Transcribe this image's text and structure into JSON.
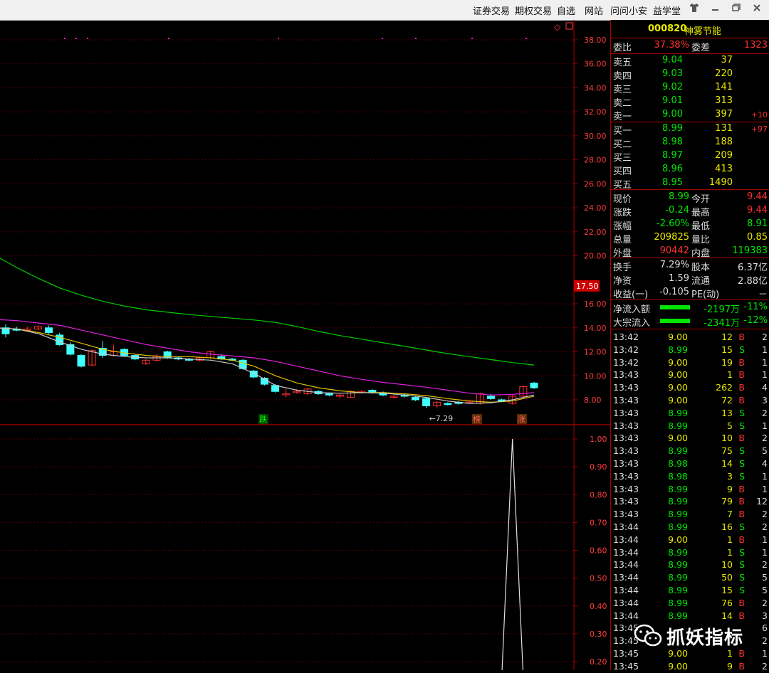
{
  "menu": {
    "items": [
      "证券交易",
      "期权交易",
      "自选",
      "网站",
      "问问小安",
      "益学堂"
    ],
    "window_controls": [
      "shirt-icon",
      "minimize-icon",
      "restore-icon",
      "close-icon"
    ]
  },
  "stock": {
    "code": "000820",
    "name": "神雾节能"
  },
  "order_ratio": {
    "label1": "委比",
    "value1": "37.38%",
    "label2": "委差",
    "value2": "1323"
  },
  "asks": [
    {
      "label": "卖五",
      "price": "9.04",
      "vol": "37",
      "change": ""
    },
    {
      "label": "卖四",
      "price": "9.03",
      "vol": "220",
      "change": ""
    },
    {
      "label": "卖三",
      "price": "9.02",
      "vol": "141",
      "change": ""
    },
    {
      "label": "卖二",
      "price": "9.01",
      "vol": "313",
      "change": ""
    },
    {
      "label": "卖一",
      "price": "9.00",
      "vol": "397",
      "change": "+10"
    }
  ],
  "bids": [
    {
      "label": "买一",
      "price": "8.99",
      "vol": "131",
      "change": "+97"
    },
    {
      "label": "买二",
      "price": "8.98",
      "vol": "188",
      "change": ""
    },
    {
      "label": "买三",
      "price": "8.97",
      "vol": "209",
      "change": ""
    },
    {
      "label": "买四",
      "price": "8.96",
      "vol": "413",
      "change": ""
    },
    {
      "label": "买五",
      "price": "8.95",
      "vol": "1490",
      "change": ""
    }
  ],
  "quote": [
    {
      "l1": "现价",
      "v1": "8.99",
      "l2": "今开",
      "v2": "9.44",
      "c1": "green",
      "c2": "red"
    },
    {
      "l1": "涨跌",
      "v1": "-0.24",
      "l2": "最高",
      "v2": "9.44",
      "c1": "green",
      "c2": "red"
    },
    {
      "l1": "涨幅",
      "v1": "-2.60%",
      "l2": "最低",
      "v2": "8.91",
      "c1": "green",
      "c2": "green"
    },
    {
      "l1": "总量",
      "v1": "209825",
      "l2": "量比",
      "v2": "0.85",
      "c1": "yellow",
      "c2": "yellow"
    },
    {
      "l1": "外盘",
      "v1": "90442",
      "l2": "内盘",
      "v2": "119383",
      "c1": "red",
      "c2": "green"
    }
  ],
  "fundamentals": [
    {
      "l1": "换手",
      "v1": "7.29%",
      "l2": "股本",
      "v2": "6.37亿"
    },
    {
      "l1": "净资",
      "v1": "1.59",
      "l2": "流通",
      "v2": "2.88亿"
    },
    {
      "l1": "收益(一)",
      "v1": "-0.105",
      "l2": "PE(动)",
      "v2": "－"
    }
  ],
  "flows": [
    {
      "label": "净流入额",
      "value": "-2197万",
      "pct": "-11%"
    },
    {
      "label": "大宗流入",
      "value": "-2341万",
      "pct": "-12%"
    }
  ],
  "ticks": [
    {
      "t": "13:42",
      "p": "9.00",
      "v": "12",
      "d": "B",
      "n": "2"
    },
    {
      "t": "13:42",
      "p": "8.99",
      "v": "15",
      "d": "S",
      "n": "1"
    },
    {
      "t": "13:42",
      "p": "9.00",
      "v": "19",
      "d": "B",
      "n": "1"
    },
    {
      "t": "13:43",
      "p": "9.00",
      "v": "1",
      "d": "B",
      "n": "1"
    },
    {
      "t": "13:43",
      "p": "9.00",
      "v": "262",
      "d": "B",
      "n": "4"
    },
    {
      "t": "13:43",
      "p": "9.00",
      "v": "72",
      "d": "B",
      "n": "3"
    },
    {
      "t": "13:43",
      "p": "8.99",
      "v": "13",
      "d": "S",
      "n": "2"
    },
    {
      "t": "13:43",
      "p": "8.99",
      "v": "5",
      "d": "S",
      "n": "1"
    },
    {
      "t": "13:43",
      "p": "9.00",
      "v": "10",
      "d": "B",
      "n": "2"
    },
    {
      "t": "13:43",
      "p": "8.99",
      "v": "75",
      "d": "S",
      "n": "5"
    },
    {
      "t": "13:43",
      "p": "8.98",
      "v": "14",
      "d": "S",
      "n": "4"
    },
    {
      "t": "13:43",
      "p": "8.98",
      "v": "3",
      "d": "S",
      "n": "1"
    },
    {
      "t": "13:43",
      "p": "8.99",
      "v": "9",
      "d": "B",
      "n": "1"
    },
    {
      "t": "13:43",
      "p": "8.99",
      "v": "79",
      "d": "B",
      "n": "12"
    },
    {
      "t": "13:43",
      "p": "8.99",
      "v": "7",
      "d": "B",
      "n": "2"
    },
    {
      "t": "13:44",
      "p": "8.99",
      "v": "16",
      "d": "S",
      "n": "2"
    },
    {
      "t": "13:44",
      "p": "9.00",
      "v": "1",
      "d": "B",
      "n": "1"
    },
    {
      "t": "13:44",
      "p": "8.99",
      "v": "1",
      "d": "S",
      "n": "1"
    },
    {
      "t": "13:44",
      "p": "8.99",
      "v": "10",
      "d": "S",
      "n": "2"
    },
    {
      "t": "13:44",
      "p": "8.99",
      "v": "50",
      "d": "S",
      "n": "5"
    },
    {
      "t": "13:44",
      "p": "8.99",
      "v": "15",
      "d": "S",
      "n": "5"
    },
    {
      "t": "13:44",
      "p": "8.99",
      "v": "76",
      "d": "B",
      "n": "2"
    },
    {
      "t": "13:44",
      "p": "8.99",
      "v": "14",
      "d": "B",
      "n": "3"
    },
    {
      "t": "13:45",
      "p": "",
      "v": "",
      "d": "",
      "n": "6"
    },
    {
      "t": "13:45",
      "p": "",
      "v": "",
      "d": "",
      "n": "2"
    },
    {
      "t": "13:45",
      "p": "9.00",
      "v": "1",
      "d": "B",
      "n": "1"
    },
    {
      "t": "13:45",
      "p": "9.00",
      "v": "9",
      "d": "B",
      "n": "2"
    }
  ],
  "watermark": {
    "text": "抓妖指标"
  },
  "chart_data": [
    {
      "type": "candlestick",
      "price_axis_ticks": [
        "38.00",
        "36.00",
        "34.00",
        "32.00",
        "30.00",
        "28.00",
        "26.00",
        "24.00",
        "22.00",
        "20.00",
        "16.00",
        "14.00",
        "12.00",
        "10.00",
        "8.00"
      ],
      "ylim": [
        6.9,
        39.2
      ],
      "crosshair_price": "17.50",
      "low_marker": "7.29",
      "event_markers": [
        "跌",
        "榜",
        "涨"
      ],
      "candles": [
        {
          "o": 14.0,
          "h": 14.3,
          "l": 13.2,
          "c": 13.5
        },
        {
          "o": 13.9,
          "h": 14.1,
          "l": 13.7,
          "c": 13.8
        },
        {
          "o": 13.8,
          "h": 14.1,
          "l": 13.7,
          "c": 13.9
        },
        {
          "o": 13.9,
          "h": 14.2,
          "l": 13.8,
          "c": 14.1
        },
        {
          "o": 14.0,
          "h": 14.2,
          "l": 13.5,
          "c": 13.6
        },
        {
          "o": 13.4,
          "h": 13.6,
          "l": 12.5,
          "c": 12.6
        },
        {
          "o": 12.6,
          "h": 12.8,
          "l": 11.7,
          "c": 11.8
        },
        {
          "o": 11.7,
          "h": 11.8,
          "l": 10.7,
          "c": 10.8
        },
        {
          "o": 10.9,
          "h": 12.2,
          "l": 10.8,
          "c": 12.1
        },
        {
          "o": 12.3,
          "h": 12.9,
          "l": 11.5,
          "c": 11.7
        },
        {
          "o": 11.7,
          "h": 12.6,
          "l": 11.6,
          "c": 12.0
        },
        {
          "o": 12.2,
          "h": 12.3,
          "l": 11.6,
          "c": 11.7
        },
        {
          "o": 11.7,
          "h": 11.8,
          "l": 11.3,
          "c": 11.4
        },
        {
          "o": 11.0,
          "h": 11.4,
          "l": 10.9,
          "c": 11.3
        },
        {
          "o": 11.3,
          "h": 11.8,
          "l": 11.2,
          "c": 11.6
        },
        {
          "o": 12.0,
          "h": 12.1,
          "l": 11.4,
          "c": 11.5
        },
        {
          "o": 11.5,
          "h": 11.6,
          "l": 11.3,
          "c": 11.4
        },
        {
          "o": 11.4,
          "h": 11.5,
          "l": 11.2,
          "c": 11.3
        },
        {
          "o": 11.3,
          "h": 11.6,
          "l": 11.2,
          "c": 11.5
        },
        {
          "o": 11.5,
          "h": 12.1,
          "l": 11.4,
          "c": 12.0
        },
        {
          "o": 11.6,
          "h": 11.8,
          "l": 11.3,
          "c": 11.4
        },
        {
          "o": 11.4,
          "h": 11.5,
          "l": 11.2,
          "c": 11.3
        },
        {
          "o": 11.3,
          "h": 11.4,
          "l": 10.5,
          "c": 10.6
        },
        {
          "o": 10.4,
          "h": 10.5,
          "l": 9.8,
          "c": 9.9
        },
        {
          "o": 9.8,
          "h": 9.9,
          "l": 9.2,
          "c": 9.3
        },
        {
          "o": 9.2,
          "h": 9.3,
          "l": 8.6,
          "c": 8.7
        },
        {
          "o": 8.5,
          "h": 8.9,
          "l": 8.2,
          "c": 8.5
        },
        {
          "o": 8.6,
          "h": 8.9,
          "l": 8.5,
          "c": 8.7
        },
        {
          "o": 8.5,
          "h": 9.0,
          "l": 8.4,
          "c": 8.9
        },
        {
          "o": 8.7,
          "h": 8.8,
          "l": 8.4,
          "c": 8.5
        },
        {
          "o": 8.5,
          "h": 8.6,
          "l": 8.3,
          "c": 8.4
        },
        {
          "o": 8.3,
          "h": 8.5,
          "l": 8.1,
          "c": 8.4
        },
        {
          "o": 8.2,
          "h": 8.8,
          "l": 8.2,
          "c": 8.7
        },
        {
          "o": 8.6,
          "h": 8.8,
          "l": 8.5,
          "c": 8.7
        },
        {
          "o": 8.8,
          "h": 8.9,
          "l": 8.5,
          "c": 8.6
        },
        {
          "o": 8.6,
          "h": 8.7,
          "l": 8.3,
          "c": 8.4
        },
        {
          "o": 8.2,
          "h": 8.4,
          "l": 8.1,
          "c": 8.3
        },
        {
          "o": 8.4,
          "h": 8.5,
          "l": 8.2,
          "c": 8.3
        },
        {
          "o": 8.2,
          "h": 8.3,
          "l": 7.9,
          "c": 8.0
        },
        {
          "o": 8.1,
          "h": 8.2,
          "l": 7.3,
          "c": 7.5
        },
        {
          "o": 7.5,
          "h": 7.9,
          "l": 7.3,
          "c": 7.8
        },
        {
          "o": 7.7,
          "h": 7.8,
          "l": 7.5,
          "c": 7.6
        },
        {
          "o": 7.8,
          "h": 7.9,
          "l": 7.6,
          "c": 7.7
        },
        {
          "o": 7.8,
          "h": 8.0,
          "l": 7.7,
          "c": 7.9
        },
        {
          "o": 7.7,
          "h": 8.6,
          "l": 7.6,
          "c": 8.5
        },
        {
          "o": 8.3,
          "h": 8.5,
          "l": 8.0,
          "c": 8.1
        },
        {
          "o": 8.0,
          "h": 8.1,
          "l": 7.8,
          "c": 7.9
        },
        {
          "o": 7.7,
          "h": 8.4,
          "l": 7.6,
          "c": 8.3
        },
        {
          "o": 8.3,
          "h": 9.2,
          "l": 8.2,
          "c": 9.1
        },
        {
          "o": 9.4,
          "h": 9.5,
          "l": 8.9,
          "c": 9.0
        }
      ],
      "ma_series": [
        {
          "color": "#00d000",
          "values": [
            20.0,
            19.0,
            18.1,
            17.3,
            16.7,
            16.2,
            15.8,
            15.5,
            15.3,
            15.1,
            14.95,
            14.8,
            14.65,
            14.45,
            14.1,
            13.7,
            13.35,
            13.05,
            12.75,
            12.45,
            12.15,
            11.85,
            11.6,
            11.35,
            11.1,
            10.9
          ]
        },
        {
          "color": "#e020e0",
          "values": [
            14.7,
            14.6,
            14.4,
            14.2,
            13.8,
            13.4,
            13.0,
            12.6,
            12.3,
            12.0,
            11.8,
            11.65,
            11.5,
            11.2,
            10.8,
            10.4,
            10.0,
            9.7,
            9.45,
            9.25,
            9.05,
            8.8,
            8.55,
            8.4,
            8.45,
            8.6
          ]
        },
        {
          "color": "#e0c000",
          "values": [
            14.0,
            13.9,
            13.6,
            13.2,
            12.7,
            12.2,
            11.9,
            11.7,
            11.6,
            11.6,
            11.5,
            11.3,
            10.8,
            10.0,
            9.4,
            9.0,
            8.75,
            8.6,
            8.6,
            8.5,
            8.35,
            8.1,
            7.9,
            7.8,
            7.9,
            8.3
          ]
        },
        {
          "color": "#c8c8c8",
          "values": [
            14.0,
            13.9,
            13.5,
            12.8,
            12.2,
            11.8,
            11.6,
            11.5,
            11.5,
            11.4,
            11.3,
            11.0,
            10.2,
            9.2,
            8.8,
            8.6,
            8.55,
            8.6,
            8.55,
            8.4,
            8.2,
            7.9,
            7.7,
            7.75,
            8.0,
            8.4
          ]
        }
      ],
      "ma_x_start_index": 0
    },
    {
      "type": "line",
      "ylabel_ticks": [
        "1.00",
        "0.90",
        "0.80",
        "0.70",
        "0.60",
        "0.50",
        "0.40",
        "0.30",
        "0.20"
      ],
      "ylim": [
        -0.07,
        1.0
      ],
      "series": [
        {
          "values": [
            0,
            0,
            0,
            0,
            0,
            0,
            0,
            0,
            0,
            0,
            0,
            0,
            0,
            0,
            0,
            0,
            0,
            0,
            0,
            0,
            0,
            0,
            0,
            0,
            0,
            0,
            0,
            0,
            0,
            0,
            0,
            0,
            0,
            0,
            0,
            0,
            0,
            0,
            0,
            0,
            0,
            0,
            0,
            0,
            0,
            0,
            0,
            1.0,
            0,
            0
          ]
        }
      ]
    }
  ],
  "colors": {
    "up": "#ff3030",
    "down": "#40ffff",
    "grid": "#8a0000",
    "axis_text": "#ff3b3b"
  }
}
